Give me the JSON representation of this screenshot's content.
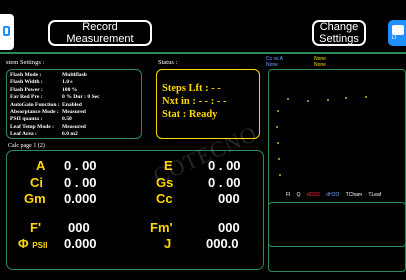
{
  "toolbar": {
    "record_label_line1": "Record",
    "record_label_line2": "Measurement",
    "change_label_line1": "Change",
    "change_label_line2": "Settings",
    "logo_right_text": "LI"
  },
  "settings": {
    "title": "stem Settings :",
    "rows": [
      {
        "label": "Flash Mode :",
        "value": "Multiflash"
      },
      {
        "label": "Flash Width :",
        "value": "1.0 s"
      },
      {
        "label": "Flash Power :",
        "value": "100 %"
      },
      {
        "label": "Far Red Pre :",
        "value": "0 %  Dur : 0 Sec"
      },
      {
        "label": "AutoGain Function :",
        "value": "Enabled"
      },
      {
        "label": "Absorptance Mode :",
        "value": "Measured"
      },
      {
        "label": "PSII quanta :",
        "value": "0.50"
      },
      {
        "label": "Leaf Temp Mode :",
        "value": "Measured"
      },
      {
        "label": "Leaf Area :",
        "value": "6.0 m2"
      }
    ]
  },
  "status": {
    "title": "Status :",
    "line1": "Steps  Lft : - -",
    "line2": "Nxt  in : - - : - -",
    "line3": "Stat : Ready"
  },
  "chart": {
    "x_label": "Cc vs A",
    "x_sub": "None",
    "y_label": "None",
    "y_sub": "None",
    "legend": [
      "Fl",
      "Q",
      "dCO2",
      "dH2O",
      "TCham",
      "TLeaf"
    ],
    "legend_colors": [
      "#ffffff",
      "#ffffff",
      "#ff3333",
      "#6fa3ff",
      "#ffffff",
      "#ffffff"
    ]
  },
  "calc": {
    "title": "Calc page 1 (2)",
    "labels": {
      "A": "A",
      "Ci": "Ci",
      "Gm": "Gm",
      "F": "F'",
      "Phi": "Φ",
      "PhiSub": "PSII",
      "E": "E",
      "Gs": "Gs",
      "Cc": "Cc",
      "Fm": "Fm'",
      "J": "J"
    },
    "values": {
      "A": "0 . 00",
      "Ci": "0 . 00",
      "Gm": "0.000",
      "F": "000",
      "Phi": "0.000",
      "E": "0 . 00",
      "Gs": "0 . 00",
      "Cc": "000",
      "Fm": "000",
      "J": "000.0"
    }
  },
  "watermark": "COTECNO"
}
